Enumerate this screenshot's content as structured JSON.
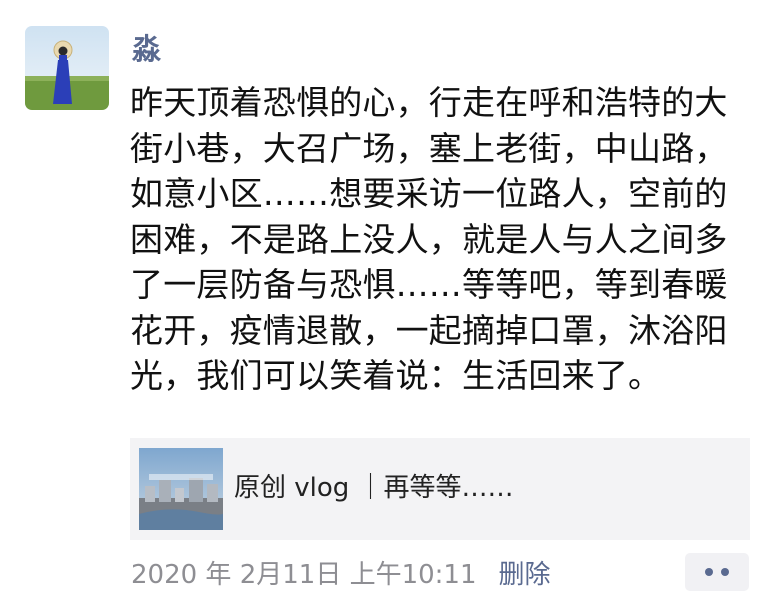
{
  "post": {
    "username": "淼",
    "text": "昨天顶着恐惧的心，行走在呼和浩特的大街小巷，大召广场，塞上老街，中山路，如意小区……想要采访一位路人，空前的困难，不是路上没人，就是人与人之间多了一层防备与恐惧……等等吧，等到春暖花开，疫情退散，一起摘掉口罩，沐浴阳光，我们可以笑着说：生活回来了。",
    "link_card": {
      "title": "原创 vlog ｜再等等……",
      "thumbnail_icon": "video-thumbnail"
    },
    "timestamp": "2020 年 2月11日 上午10:11",
    "delete_label": "删除",
    "more_icon": "more-dots-icon"
  },
  "colors": {
    "username": "#5a6a90",
    "link": "#5a6a90",
    "timestamp": "#8e8e93",
    "card_background": "#f3f3f5"
  }
}
